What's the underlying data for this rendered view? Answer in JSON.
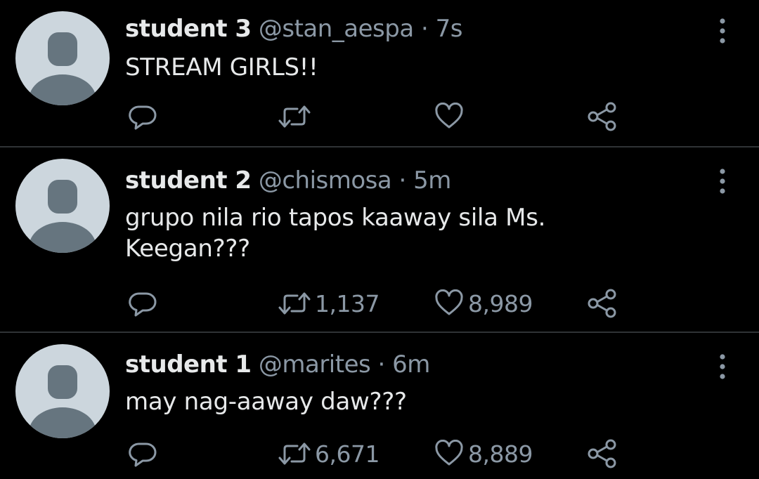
{
  "tweets": [
    {
      "name": "student 3",
      "handle": "@stan_aespa",
      "separator": "·",
      "time": "7s",
      "text": "STREAM GIRLS!!",
      "retweets": "",
      "likes": ""
    },
    {
      "name": "student 2",
      "handle": "@chismosa",
      "separator": "·",
      "time": "5m",
      "text": "grupo nila rio tapos kaaway sila Ms. Keegan???",
      "retweets": "1,137",
      "likes": "8,989"
    },
    {
      "name": "student 1",
      "handle": "@marites",
      "separator": "·",
      "time": "6m",
      "text": "may nag-aaway daw???",
      "retweets": "6,671",
      "likes": "8,889"
    }
  ],
  "icons": {
    "reply": "reply-icon",
    "retweet": "retweet-icon",
    "like": "like-icon",
    "share": "share-icon",
    "more": "more-vertical-icon",
    "avatar": "default-avatar-icon"
  },
  "colors": {
    "background": "#000000",
    "text": "#e7e9ea",
    "secondary": "#8b98a5",
    "divider": "#2f3336",
    "avatar_bg": "#ccd6dd",
    "avatar_fg": "#66757f"
  }
}
